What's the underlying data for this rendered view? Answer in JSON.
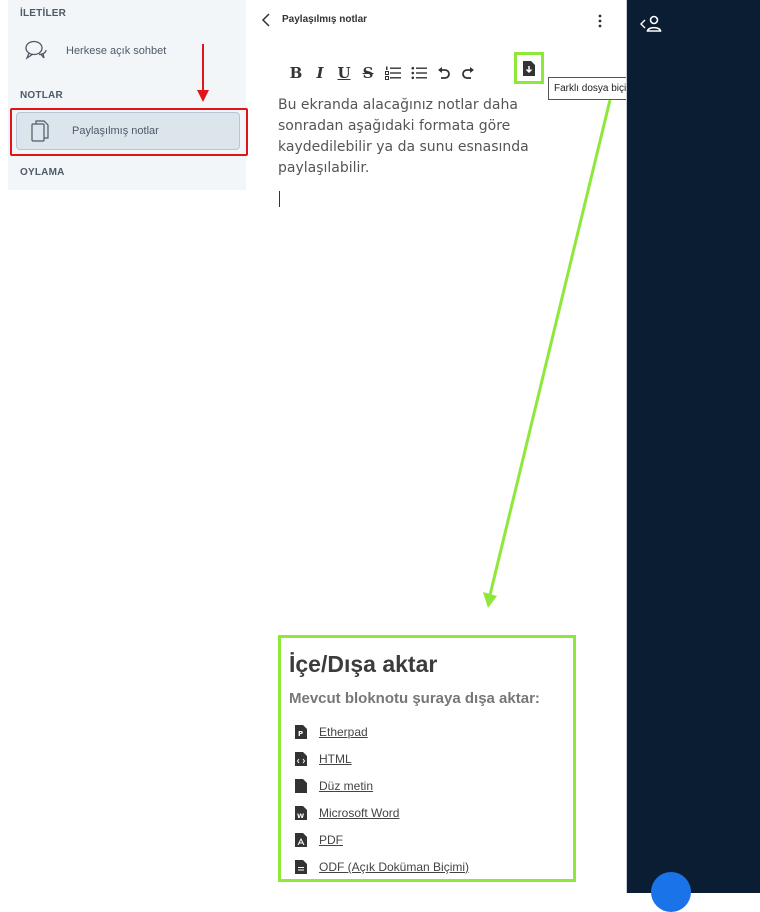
{
  "sidebar": {
    "messages_title": "İLETİLER",
    "public_chat": "Herkese açık sohbet",
    "notes_title": "NOTLAR",
    "shared_notes": "Paylaşılmış notlar",
    "polling_title": "OYLAMA"
  },
  "notes_panel": {
    "title": "Paylaşılmış notlar",
    "editor_text": "Bu ekranda alacağınız notlar daha sonradan aşağıdaki formata göre kaydedilebilir ya da sunu esnasında paylaşılabilir.",
    "toolbar": {
      "bold": "B",
      "italic": "I",
      "underline": "U",
      "strike": "S"
    },
    "export_tooltip": "Farklı dosya biçimlerini içe/dışa aktar"
  },
  "export_card": {
    "title": "İçe/Dışa aktar",
    "subtitle": "Mevcut bloknotu şuraya dışa aktar:",
    "formats": [
      {
        "label": "Etherpad",
        "icon": "file-etherpad-icon"
      },
      {
        "label": "HTML",
        "icon": "file-code-icon"
      },
      {
        "label": "Düz metin",
        "icon": "file-text-icon"
      },
      {
        "label": "Microsoft Word",
        "icon": "file-word-icon"
      },
      {
        "label": "PDF",
        "icon": "file-pdf-icon"
      },
      {
        "label": "ODF (Açık Doküman Biçimi)",
        "icon": "file-odf-icon"
      }
    ]
  },
  "colors": {
    "annotation_red": "#e0151b",
    "annotation_green": "#8ee83a",
    "dark_sidebar": "#0b1d33",
    "fab_blue": "#1a73e8"
  }
}
